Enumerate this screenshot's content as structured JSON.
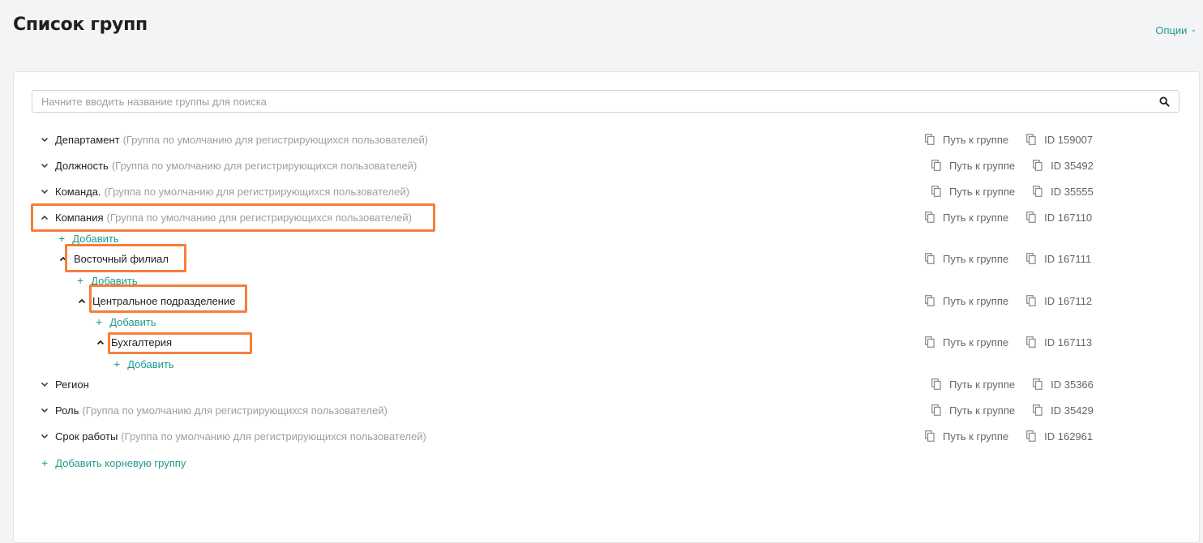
{
  "page": {
    "title": "Список групп",
    "options_label": "Опции"
  },
  "search": {
    "placeholder": "Начните вводить название группы для поиска"
  },
  "actions": {
    "path_label": "Путь к группе"
  },
  "tree": [
    {
      "name": "Департамент",
      "hint": "(Группа по умолчанию для регистрирующихся пользователей)",
      "id": "ID 159007",
      "expanded": false
    },
    {
      "name": "Должность",
      "hint": "(Группа по умолчанию для регистрирующихся пользователей)",
      "id": "ID 35492",
      "expanded": false
    },
    {
      "name": "Команда.",
      "hint": "(Группа по умолчанию для регистрирующихся пользователей)",
      "id": "ID 35555",
      "expanded": false
    },
    {
      "name": "Компания",
      "hint": "(Группа по умолчанию для регистрирующихся пользователей)",
      "id": "ID 167110",
      "expanded": true,
      "add_label": "Добавить"
    },
    {
      "name": "Восточный филиал",
      "hint": "",
      "id": "ID 167111",
      "expanded": true,
      "add_label": "Добавить"
    },
    {
      "name": "Центральное подразделение",
      "hint": "",
      "id": "ID 167112",
      "expanded": true,
      "add_label": "Добавить"
    },
    {
      "name": "Бухгалтерия",
      "hint": "",
      "id": "ID 167113",
      "expanded": true,
      "add_label": "Добавить"
    },
    {
      "name": "Регион",
      "hint": "",
      "id": "ID 35366",
      "expanded": false
    },
    {
      "name": "Роль",
      "hint": "(Группа по умолчанию для регистрирующихся пользователей)",
      "id": "ID 35429",
      "expanded": false
    },
    {
      "name": "Срок работы",
      "hint": "(Группа по умолчанию для регистрирующихся пользователей)",
      "id": "ID 162961",
      "expanded": false
    }
  ],
  "footer": {
    "add_root_label": "Добавить корневую группу"
  },
  "colors": {
    "accent": "#1f9a8c",
    "highlight": "#f57f3b",
    "hint": "#9aa0a4"
  }
}
